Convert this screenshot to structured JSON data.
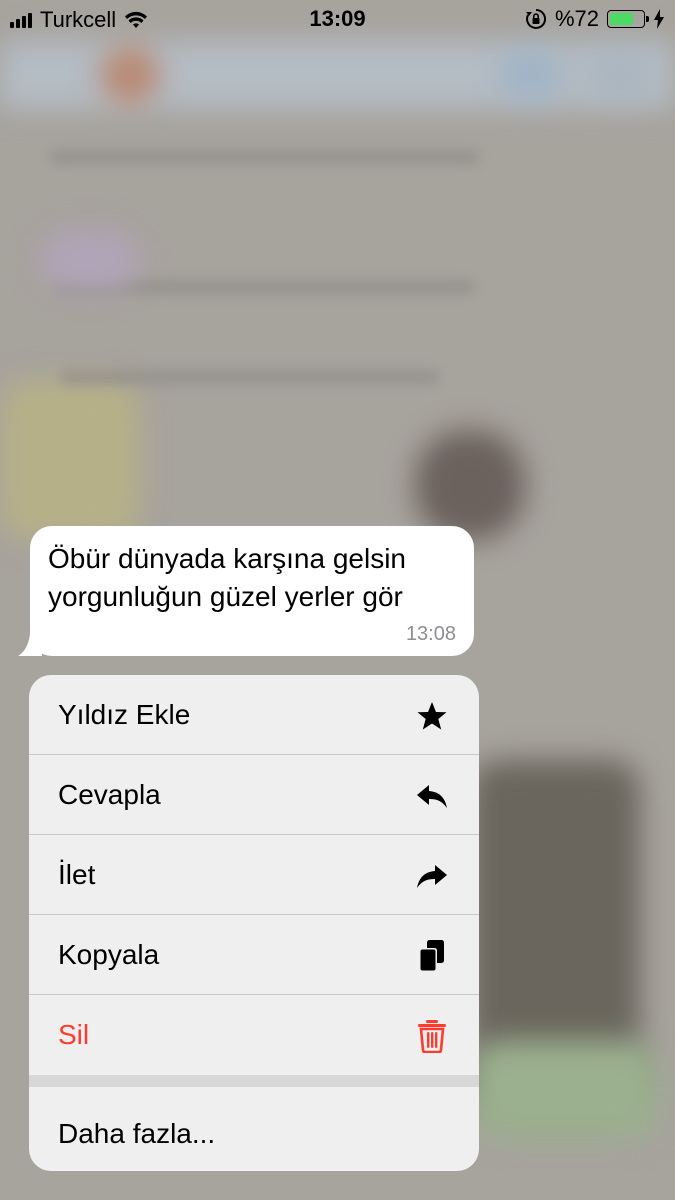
{
  "status_bar": {
    "carrier": "Turkcell",
    "time": "13:09",
    "battery_percent": "%72",
    "battery_level": 0.72
  },
  "message": {
    "line1": "Öbür dünyada karşına gelsin",
    "line2": "yorgunluğun güzel yerler gör",
    "time": "13:08"
  },
  "menu": {
    "items": [
      {
        "label": "Yıldız Ekle",
        "icon": "star-icon"
      },
      {
        "label": "Cevapla",
        "icon": "reply-icon"
      },
      {
        "label": "İlet",
        "icon": "forward-icon"
      },
      {
        "label": "Kopyala",
        "icon": "copy-icon"
      },
      {
        "label": "Sil",
        "icon": "trash-icon",
        "color": "#ff3b30"
      }
    ],
    "more_label": "Daha fazla..."
  },
  "colors": {
    "destructive": "#ff3b30",
    "battery_fill": "#4cd964",
    "backdrop": "#a7a39d"
  }
}
